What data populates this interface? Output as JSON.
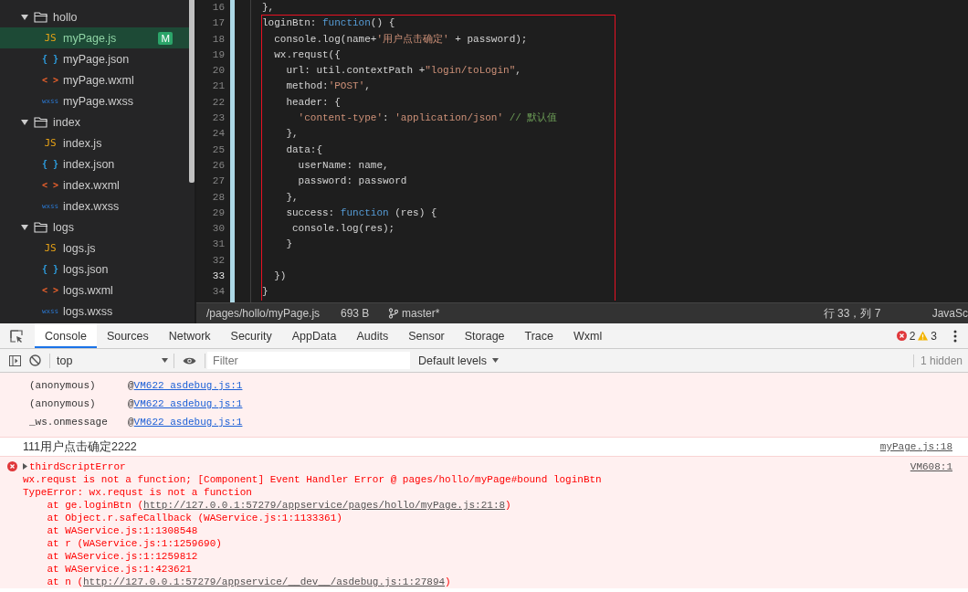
{
  "sidebar": {
    "items": [
      {
        "kind": "folder",
        "name": "hollo",
        "expanded": true,
        "children": [
          {
            "kind": "js",
            "glyph": "JS",
            "name": "myPage.js",
            "selected": true,
            "badge": "M"
          },
          {
            "kind": "json",
            "glyph": "{ }",
            "name": "myPage.json",
            "selected": false
          },
          {
            "kind": "wxml",
            "glyph": "< >",
            "name": "myPage.wxml",
            "selected": false
          },
          {
            "kind": "wxss",
            "glyph": "wxss",
            "name": "myPage.wxss",
            "selected": false
          }
        ]
      },
      {
        "kind": "folder",
        "name": "index",
        "expanded": true,
        "children": [
          {
            "kind": "js",
            "glyph": "JS",
            "name": "index.js",
            "selected": false
          },
          {
            "kind": "json",
            "glyph": "{ }",
            "name": "index.json",
            "selected": false
          },
          {
            "kind": "wxml",
            "glyph": "< >",
            "name": "index.wxml",
            "selected": false
          },
          {
            "kind": "wxss",
            "glyph": "wxss",
            "name": "index.wxss",
            "selected": false
          }
        ]
      },
      {
        "kind": "folder",
        "name": "logs",
        "expanded": true,
        "children": [
          {
            "kind": "js",
            "glyph": "JS",
            "name": "logs.js",
            "selected": false
          },
          {
            "kind": "json",
            "glyph": "{ }",
            "name": "logs.json",
            "selected": false
          },
          {
            "kind": "wxml",
            "glyph": "< >",
            "name": "logs.wxml",
            "selected": false
          },
          {
            "kind": "wxss",
            "glyph": "wxss",
            "name": "logs.wxss",
            "selected": false
          }
        ]
      }
    ]
  },
  "editor": {
    "lines": [
      {
        "number": "16",
        "current": false,
        "tokens": [
          {
            "kind": "plain",
            "text": "},"
          }
        ]
      }
    ],
    "highlighted_block": {
      "lines": [
        {
          "number": "17",
          "current": false,
          "tokens": [
            {
              "kind": "plain",
              "text": "loginBtn: "
            },
            {
              "kind": "keyword",
              "text": "function"
            },
            {
              "kind": "plain",
              "text": "() {"
            }
          ]
        },
        {
          "number": "18",
          "current": false,
          "tokens": [
            {
              "kind": "plain",
              "text": "  console.log(name+"
            },
            {
              "kind": "string",
              "text": "'用户点击确定'"
            },
            {
              "kind": "plain",
              "text": " + password);"
            }
          ]
        },
        {
          "number": "19",
          "current": false,
          "tokens": [
            {
              "kind": "plain",
              "text": "  wx.requst({"
            }
          ]
        },
        {
          "number": "20",
          "current": false,
          "tokens": [
            {
              "kind": "plain",
              "text": "    url: util.contextPath +"
            },
            {
              "kind": "string",
              "text": "\"login/toLogin\""
            },
            {
              "kind": "plain",
              "text": ","
            }
          ]
        },
        {
          "number": "21",
          "current": false,
          "tokens": [
            {
              "kind": "plain",
              "text": "    method:"
            },
            {
              "kind": "string",
              "text": "'POST'"
            },
            {
              "kind": "plain",
              "text": ","
            }
          ]
        },
        {
          "number": "22",
          "current": false,
          "tokens": [
            {
              "kind": "plain",
              "text": "    header: {"
            }
          ]
        },
        {
          "number": "23",
          "current": false,
          "tokens": [
            {
              "kind": "string",
              "text": "      'content-type'"
            },
            {
              "kind": "plain",
              "text": ": "
            },
            {
              "kind": "string",
              "text": "'application/json'"
            },
            {
              "kind": "comment",
              "text": " // 默认值"
            }
          ]
        },
        {
          "number": "24",
          "current": false,
          "tokens": [
            {
              "kind": "plain",
              "text": "    },"
            }
          ]
        },
        {
          "number": "25",
          "current": false,
          "tokens": [
            {
              "kind": "plain",
              "text": "    data:{"
            }
          ]
        },
        {
          "number": "26",
          "current": false,
          "tokens": [
            {
              "kind": "plain",
              "text": "      userName: name,"
            }
          ]
        },
        {
          "number": "27",
          "current": false,
          "tokens": [
            {
              "kind": "plain",
              "text": "      password: password"
            }
          ]
        },
        {
          "number": "28",
          "current": false,
          "tokens": [
            {
              "kind": "plain",
              "text": "    },"
            }
          ]
        },
        {
          "number": "29",
          "current": false,
          "tokens": [
            {
              "kind": "plain",
              "text": "    success: "
            },
            {
              "kind": "keyword",
              "text": "function"
            },
            {
              "kind": "plain",
              "text": " (res) {"
            }
          ]
        },
        {
          "number": "30",
          "current": false,
          "tokens": [
            {
              "kind": "plain",
              "text": "     console.log(res);"
            }
          ]
        },
        {
          "number": "31",
          "current": false,
          "tokens": [
            {
              "kind": "plain",
              "text": "    }"
            }
          ]
        },
        {
          "number": "32",
          "current": false
        },
        {
          "number": "33",
          "current": true,
          "tokens": [
            {
              "kind": "plain",
              "text": "  })"
            }
          ]
        },
        {
          "number": "34",
          "current": false,
          "tokens": [
            {
              "kind": "plain",
              "text": "}"
            }
          ]
        }
      ]
    }
  },
  "status_bar": {
    "path": "/pages/hollo/myPage.js",
    "size": "693 B",
    "branch": "master*",
    "cursor": "行 33，列 7",
    "language": "JavaSc"
  },
  "devtools": {
    "tabs": [
      {
        "label": "Console",
        "selected": true
      },
      {
        "label": "Sources",
        "selected": false
      },
      {
        "label": "Network",
        "selected": false
      },
      {
        "label": "Security",
        "selected": false
      },
      {
        "label": "AppData",
        "selected": false
      },
      {
        "label": "Audits",
        "selected": false
      },
      {
        "label": "Sensor",
        "selected": false
      },
      {
        "label": "Storage",
        "selected": false
      },
      {
        "label": "Trace",
        "selected": false
      },
      {
        "label": "Wxml",
        "selected": false
      }
    ],
    "errors": "2",
    "warnings": "3",
    "toolbar": {
      "context": "top",
      "filter_placeholder": "Filter",
      "levels": "Default levels",
      "hidden": "1 hidden"
    },
    "messages": [
      {
        "kind": "stack",
        "function": "(anonymous)",
        "at": "@",
        "source": "VM622 asdebug.js:1"
      },
      {
        "kind": "stack",
        "function": "(anonymous)",
        "at": "@",
        "source": "VM622 asdebug.js:1"
      },
      {
        "kind": "stack",
        "function": "_ws.onmessage",
        "at": "@",
        "source": "VM622 asdebug.js:1"
      },
      {
        "kind": "log",
        "text": "111用户点击确定2222",
        "source": "myPage.js:18"
      },
      {
        "kind": "error",
        "title": "thirdScriptError",
        "expanded": false,
        "source": "VM608:1",
        "lines": [
          [
            {
              "text": "wx.requst is not a function; [Component] Event Handler Error @ pages/hollo/myPage#bound loginBtn",
              "link": false
            }
          ],
          [
            {
              "text": "TypeError: wx.requst is not a function",
              "link": false
            }
          ],
          [
            {
              "text": "    at ge.loginBtn (",
              "link": false
            },
            {
              "text": "http://127.0.0.1:57279/appservice/pages/hollo/myPage.js:21:8",
              "link": true
            },
            {
              "text": ")",
              "link": false
            }
          ],
          [
            {
              "text": "    at Object.r.safeCallback (WAService.js:1:1133361)",
              "link": false
            }
          ],
          [
            {
              "text": "    at WAService.js:1:1308548",
              "link": false
            }
          ],
          [
            {
              "text": "    at r (WAService.js:1:1259690)",
              "link": false
            }
          ],
          [
            {
              "text": "    at WAService.js:1:1259812",
              "link": false
            }
          ],
          [
            {
              "text": "    at WAService.js:1:423621",
              "link": false
            }
          ],
          [
            {
              "text": "    at n (",
              "link": false
            },
            {
              "text": "http://127.0.0.1:57279/appservice/__dev__/asdebug.js:1:27894",
              "link": true
            },
            {
              "text": ")",
              "link": false
            }
          ]
        ]
      }
    ]
  }
}
